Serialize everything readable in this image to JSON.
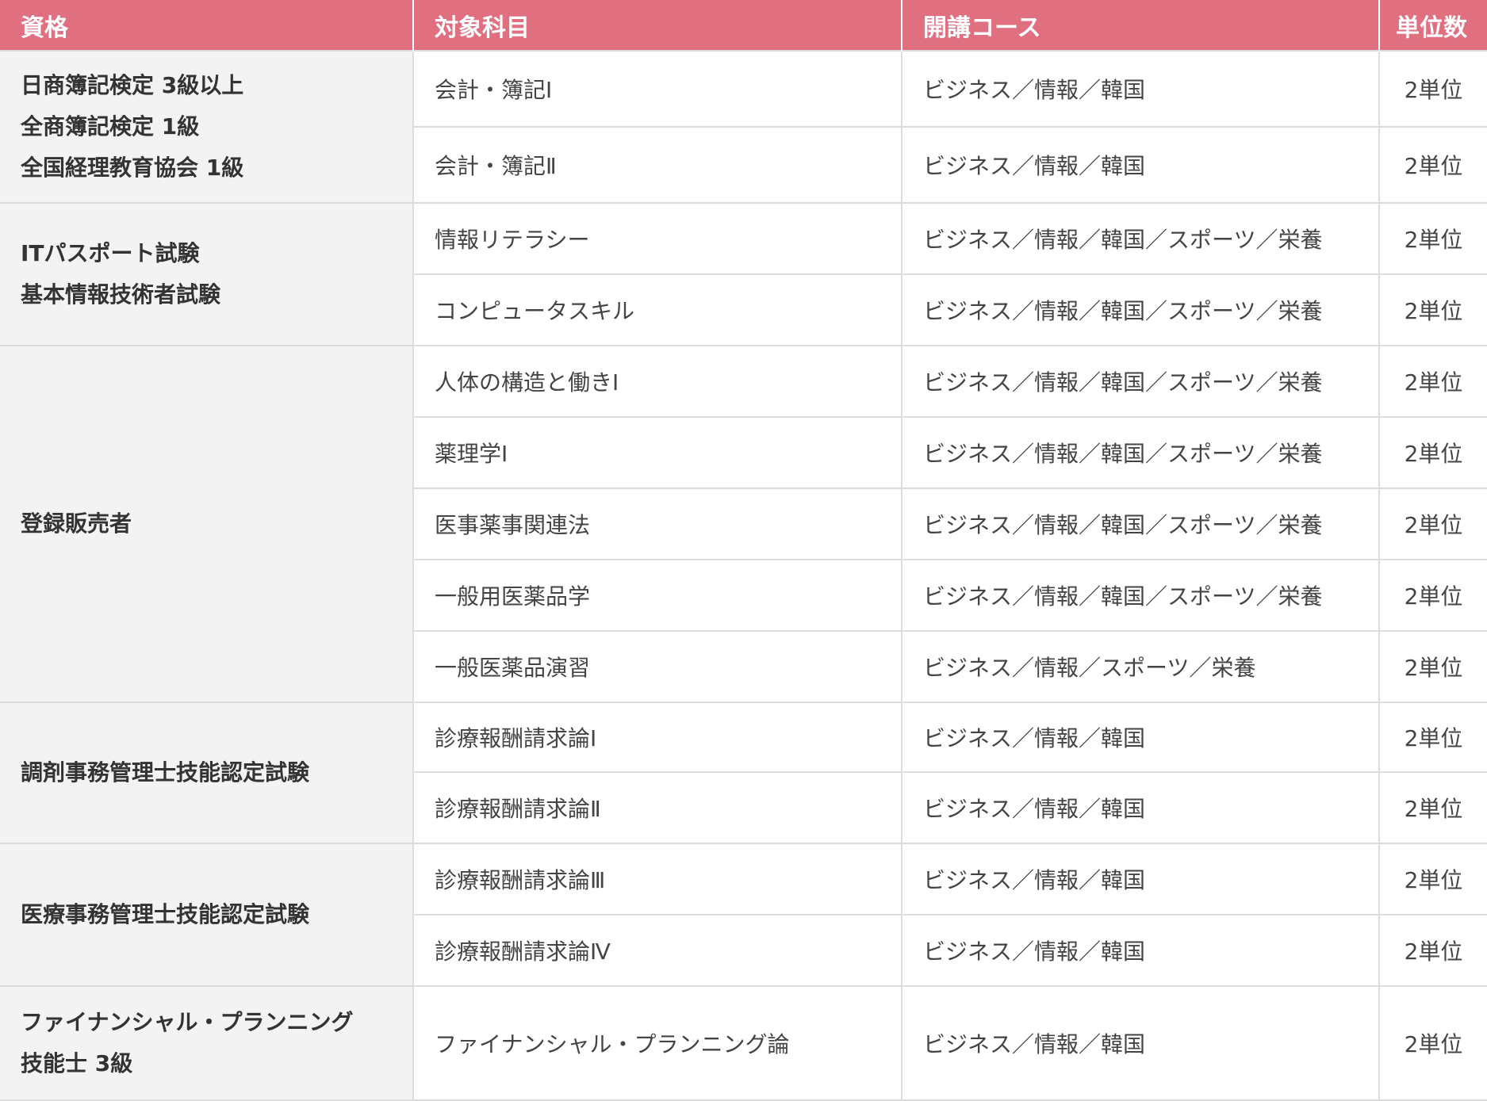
{
  "table": {
    "headers": {
      "qualification": "資格",
      "subject": "対象科目",
      "course": "開講コース",
      "credits": "単位数"
    },
    "groups": [
      {
        "qualification_lines": [
          "日商簿記検定 3級以上",
          "全商簿記検定 1級",
          "全国経理教育協会 1級"
        ],
        "rows": [
          {
            "subject": "会計・簿記Ⅰ",
            "course": "ビジネス／情報／韓国",
            "credits": "2単位"
          },
          {
            "subject": "会計・簿記Ⅱ",
            "course": "ビジネス／情報／韓国",
            "credits": "2単位"
          }
        ]
      },
      {
        "qualification_lines": [
          "ITパスポート試験",
          "基本情報技術者試験"
        ],
        "rows": [
          {
            "subject": "情報リテラシー",
            "course": "ビジネス／情報／韓国／スポーツ／栄養",
            "credits": "2単位"
          },
          {
            "subject": "コンピュータスキル",
            "course": "ビジネス／情報／韓国／スポーツ／栄養",
            "credits": "2単位"
          }
        ]
      },
      {
        "qualification_lines": [
          "登録販売者"
        ],
        "rows": [
          {
            "subject": "人体の構造と働きⅠ",
            "course": "ビジネス／情報／韓国／スポーツ／栄養",
            "credits": "2単位"
          },
          {
            "subject": "薬理学Ⅰ",
            "course": "ビジネス／情報／韓国／スポーツ／栄養",
            "credits": "2単位"
          },
          {
            "subject": "医事薬事関連法",
            "course": "ビジネス／情報／韓国／スポーツ／栄養",
            "credits": "2単位"
          },
          {
            "subject": "一般用医薬品学",
            "course": "ビジネス／情報／韓国／スポーツ／栄養",
            "credits": "2単位"
          },
          {
            "subject": "一般医薬品演習",
            "course": "ビジネス／情報／スポーツ／栄養",
            "credits": "2単位"
          }
        ]
      },
      {
        "qualification_lines": [
          "調剤事務管理士技能認定試験"
        ],
        "rows": [
          {
            "subject": "診療報酬請求論Ⅰ",
            "course": "ビジネス／情報／韓国",
            "credits": "2単位"
          },
          {
            "subject": "診療報酬請求論Ⅱ",
            "course": "ビジネス／情報／韓国",
            "credits": "2単位"
          }
        ]
      },
      {
        "qualification_lines": [
          "医療事務管理士技能認定試験"
        ],
        "rows": [
          {
            "subject": "診療報酬請求論Ⅲ",
            "course": "ビジネス／情報／韓国",
            "credits": "2単位"
          },
          {
            "subject": "診療報酬請求論Ⅳ",
            "course": "ビジネス／情報／韓国",
            "credits": "2単位"
          }
        ]
      },
      {
        "qualification_lines": [
          "ファイナンシャル・プランニング",
          "技能士 3級"
        ],
        "rows": [
          {
            "subject": "ファイナンシャル・プランニング論",
            "course": "ビジネス／情報／韓国",
            "credits": "2単位"
          }
        ]
      }
    ]
  },
  "colors": {
    "header_bg": "#e06f80",
    "header_text": "#ffffff",
    "qualification_bg": "#f3f3f3",
    "border": "#dcdcdc"
  }
}
